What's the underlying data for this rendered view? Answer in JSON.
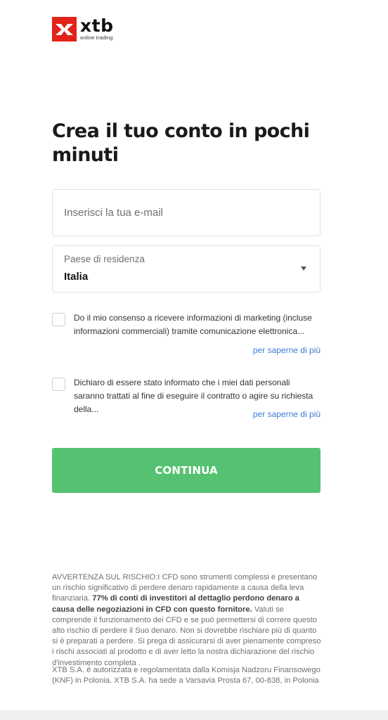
{
  "brand": {
    "name": "xtb",
    "tagline": "online trading",
    "color": "#e2231a"
  },
  "title": "Crea il tuo conto in pochi minuti",
  "email": {
    "placeholder": "Inserisci la tua e-mail",
    "value": ""
  },
  "country": {
    "label": "Paese di residenza",
    "value": "Italia"
  },
  "consents": [
    {
      "text": "Do il mio consenso a ricevere informazioni di marketing (incluse informazioni commerciali) tramite comunicazione elettronica...",
      "link": "per saperne di più",
      "checked": false
    },
    {
      "text": "Dichiaro di essere stato informato che i miei dati personali saranno trattati al fine di eseguire il contratto o agire su richiesta della...",
      "link": "per saperne di più",
      "checked": false
    }
  ],
  "continue_label": "CONTINUA",
  "continue_color": "#56c271",
  "risk_warning": {
    "intro": "AVVERTENZA SUL RISCHIO:I CFD sono strumenti complessi e presentano un rischio significativo di perdere denaro rapidamente a causa della leva finanziaria.",
    "bold": "77% di conti di investitori al dettaglio perdono denaro a causa delle negoziazioni in CFD con questo fornitore.",
    "rest": "Valuti se comprende il funzionamento dei CFD e se può permettersi di correre questo alto rischio di perdere il Suo denaro. Non si dovrebbe rischiare più di quanto si è preparati a perdere. Si prega di assicurarsi di aver pienamente compreso i rischi associati al prodotto e di aver letto la nostra dichiarazione del rischio d'investimento completa ."
  },
  "legal_text": "XTB S.A. è autorizzata e regolamentata dalla Komisja Nadzoru Finansowego (KNF) in Polonia. XTB S.A. ha sede a Varsavia Prosta 67, 00-838, in Polonia"
}
